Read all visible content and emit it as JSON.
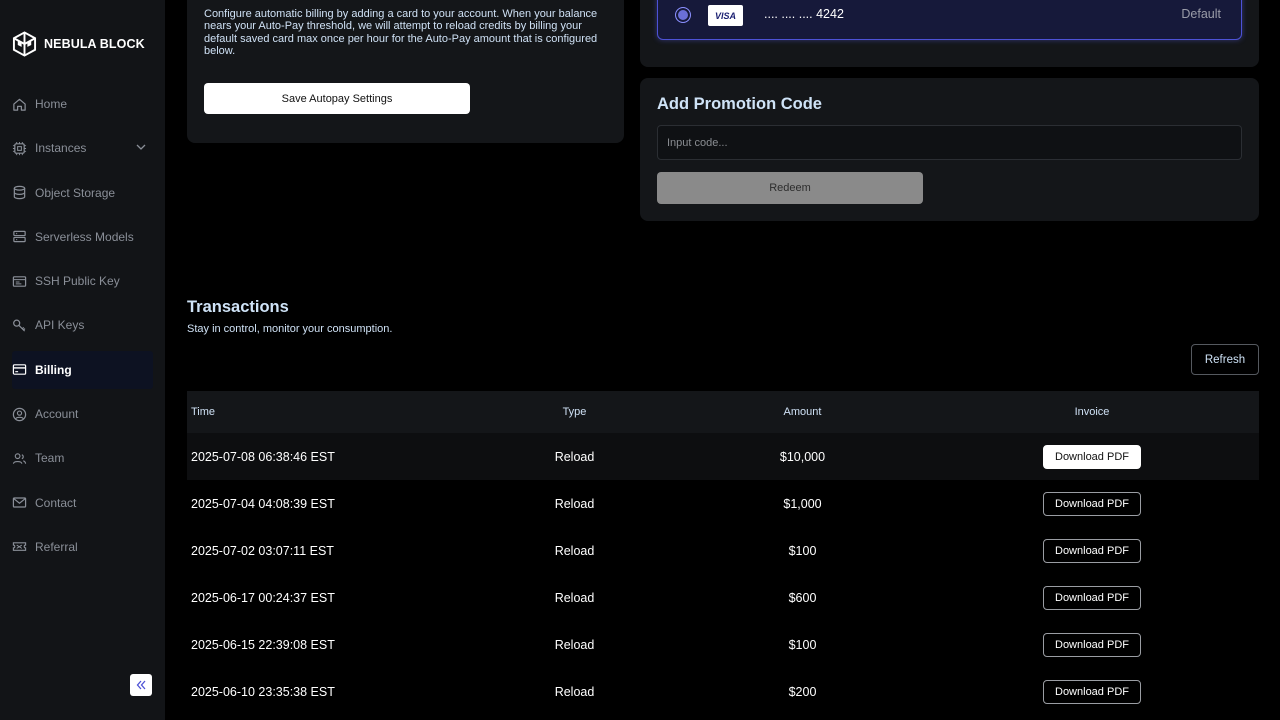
{
  "brand": {
    "name": "NEBULA BLOCK"
  },
  "sidebar": {
    "items": [
      {
        "label": "Home",
        "icon": "home-icon"
      },
      {
        "label": "Instances",
        "icon": "chip-icon",
        "expandable": true
      },
      {
        "label": "Object Storage",
        "icon": "database-icon"
      },
      {
        "label": "Serverless Models",
        "icon": "server-icon"
      },
      {
        "label": "SSH Public Key",
        "icon": "ssh-key-icon"
      },
      {
        "label": "API Keys",
        "icon": "key-icon"
      },
      {
        "label": "Billing",
        "icon": "credit-card-icon",
        "active": true
      },
      {
        "label": "Account",
        "icon": "user-circle-icon"
      },
      {
        "label": "Team",
        "icon": "team-icon"
      },
      {
        "label": "Contact",
        "icon": "mail-icon"
      },
      {
        "label": "Referral",
        "icon": "ticket-icon"
      }
    ]
  },
  "autopay": {
    "description": "Configure automatic billing by adding a card to your account. When your balance nears your Auto-Pay threshold, we will attempt to reload credits by billing your default saved card max once per hour for the Auto-Pay amount that is configured below.",
    "save_label": "Save Autopay Settings"
  },
  "card": {
    "brand": "VISA",
    "number": ".... .... .... 4242",
    "status": "Default"
  },
  "promo": {
    "title": "Add Promotion Code",
    "placeholder": "Input code...",
    "redeem_label": "Redeem"
  },
  "transactions": {
    "title": "Transactions",
    "subtitle": "Stay in control, monitor your consumption.",
    "refresh_label": "Refresh",
    "columns": {
      "time": "Time",
      "type": "Type",
      "amount": "Amount",
      "invoice": "Invoice"
    },
    "download_label": "Download PDF",
    "rows": [
      {
        "time": "2025-07-08 06:38:46 EST",
        "type": "Reload",
        "amount": "$10,000"
      },
      {
        "time": "2025-07-04 04:08:39 EST",
        "type": "Reload",
        "amount": "$1,000"
      },
      {
        "time": "2025-07-02 03:07:11 EST",
        "type": "Reload",
        "amount": "$100"
      },
      {
        "time": "2025-06-17 00:24:37 EST",
        "type": "Reload",
        "amount": "$600"
      },
      {
        "time": "2025-06-15 22:39:08 EST",
        "type": "Reload",
        "amount": "$100"
      },
      {
        "time": "2025-06-10 23:35:38 EST",
        "type": "Reload",
        "amount": "$200"
      }
    ]
  },
  "colors": {
    "accent": "#4d52d6",
    "sidebar_bg": "#121417",
    "panel_bg": "#141619",
    "heading": "#cfe3f7"
  }
}
